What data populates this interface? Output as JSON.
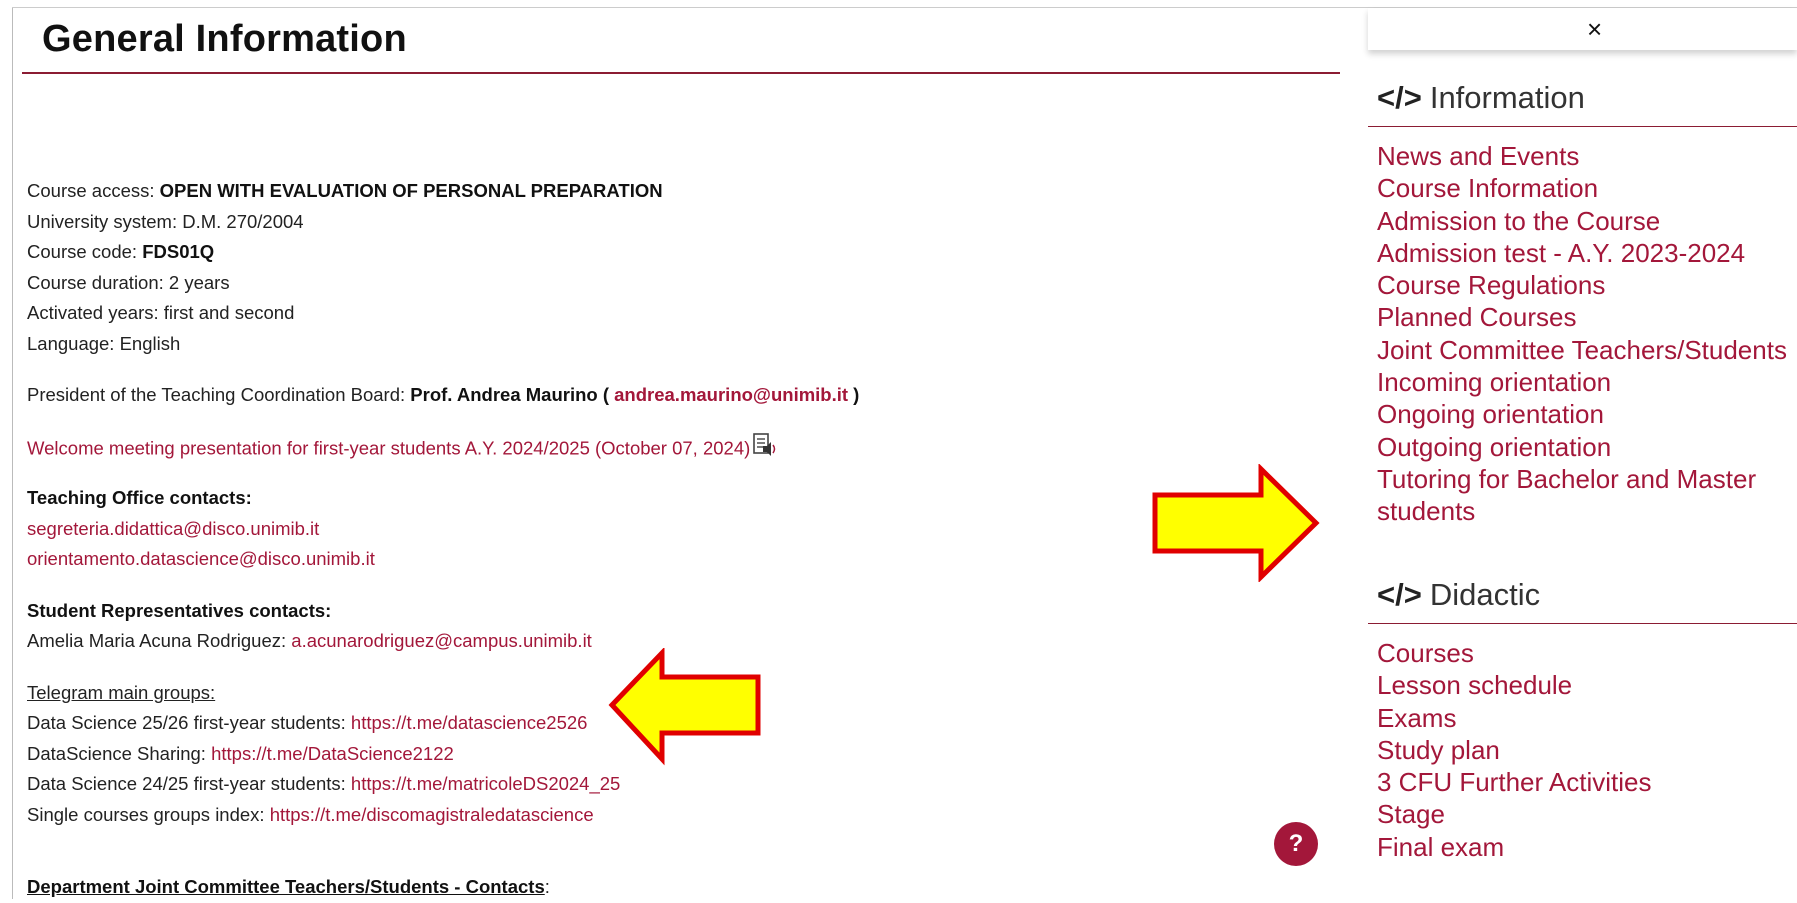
{
  "page_title": "General Information",
  "content": {
    "course_access_label": "Course access: ",
    "course_access_value": "OPEN WITH EVALUATION OF PERSONAL PREPARATION",
    "university_system": "University system: D.M. 270/2004",
    "course_code_label": "Course code: ",
    "course_code_value": "FDS01Q",
    "course_duration": "Course duration: 2 years",
    "activated_years": "Activated years: first and second",
    "language": "Language: English",
    "president_label": "President of the Teaching Coordination Board: ",
    "president_name": "Prof. Andrea Maurino ( ",
    "president_email": "andrea.maurino@unimib.it",
    "president_close": " )",
    "welcome_meeting": "Welcome meeting presentation for first-year students A.Y. 2024/2025 (October 07, 2024)",
    "teaching_office_heading": "Teaching Office contacts:",
    "teaching_office_emails": [
      "segreteria.didattica@disco.unimib.it",
      "orientamento.datascience@disco.unimib.it"
    ],
    "student_reps_heading": "Student Representatives contacts:",
    "student_rep_name": "Amelia Maria Acuna Rodriguez: ",
    "student_rep_email": "a.acunarodriguez@campus.unimib.it",
    "telegram_heading": "Telegram main groups:",
    "telegram_groups": [
      {
        "label": "Data Science 25/26 first-year students: ",
        "link": "https://t.me/datascience2526"
      },
      {
        "label": "DataScience Sharing: ",
        "link": "https://t.me/DataScience2122"
      },
      {
        "label": "Data Science 24/25 first-year students: ",
        "link": "https://t.me/matricoleDS2024_25"
      },
      {
        "label": "Single courses groups index: ",
        "link": "https://t.me/discomagistraledatascience"
      }
    ],
    "joint_committee_label": "Department Joint Committee Teachers/Students - Contacts",
    "joint_committee_suffix": ":"
  },
  "help_button": "?",
  "sidebar": {
    "close_symbol": "×",
    "code_icon_glyph": "</>",
    "sections": [
      {
        "title": "Information",
        "items": [
          "News and Events",
          "Course Information",
          "Admission to the Course",
          "Admission test - A.Y. 2023-2024",
          "Course Regulations",
          "Planned Courses",
          "Joint Committee Teachers/Students",
          "Incoming orientation",
          "Ongoing orientation",
          "Outgoing orientation",
          "Tutoring for Bachelor and Master",
          "students"
        ]
      },
      {
        "title": "Didactic",
        "items": [
          "Courses",
          "Lesson schedule",
          "Exams",
          "Study plan",
          "3 CFU Further Activities",
          "Stage",
          "Final exam"
        ]
      }
    ]
  },
  "colors": {
    "accent": "#a3173a",
    "arrow_fill": "#ffff00",
    "arrow_stroke": "#e00000"
  }
}
